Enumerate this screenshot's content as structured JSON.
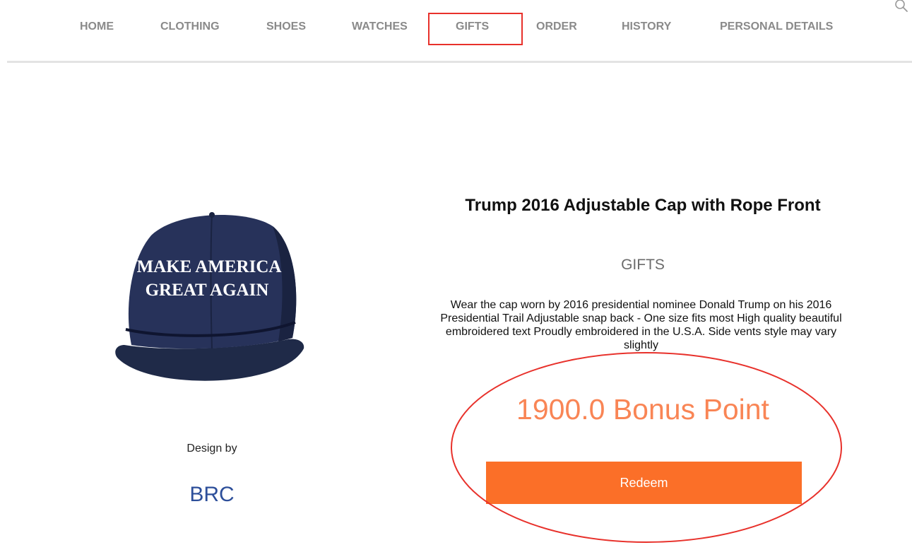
{
  "nav": {
    "items": [
      {
        "label": "HOME"
      },
      {
        "label": "CLOTHING"
      },
      {
        "label": "SHOES"
      },
      {
        "label": "WATCHES"
      },
      {
        "label": "GIFTS",
        "highlighted": true
      },
      {
        "label": "ORDER"
      },
      {
        "label": "HISTORY"
      },
      {
        "label": "PERSONAL DETAILS"
      }
    ],
    "search_icon": "search-icon",
    "highlight_color": "#e8312b"
  },
  "product": {
    "image_text_line1": "MAKE AMERICA",
    "image_text_line2": "GREAT AGAIN",
    "design_by": "Design by",
    "brand": "BRC",
    "title": "Trump 2016 Adjustable Cap with Rope Front",
    "category": "GIFTS",
    "description": "Wear the cap worn by 2016 presidential nominee Donald Trump on his 2016 Presidential Trail Adjustable snap back - One size fits most High quality beautiful embroidered text Proudly embroidered in the U.S.A. Side vents style may vary slightly",
    "points": "1900.0 Bonus Point",
    "redeem_label": "Redeem"
  },
  "colors": {
    "accent": "#fb6f28",
    "points": "#f98555",
    "brand": "#2d4f9a",
    "nav_text": "#8a8a8a",
    "annotation": "#e8312b"
  }
}
